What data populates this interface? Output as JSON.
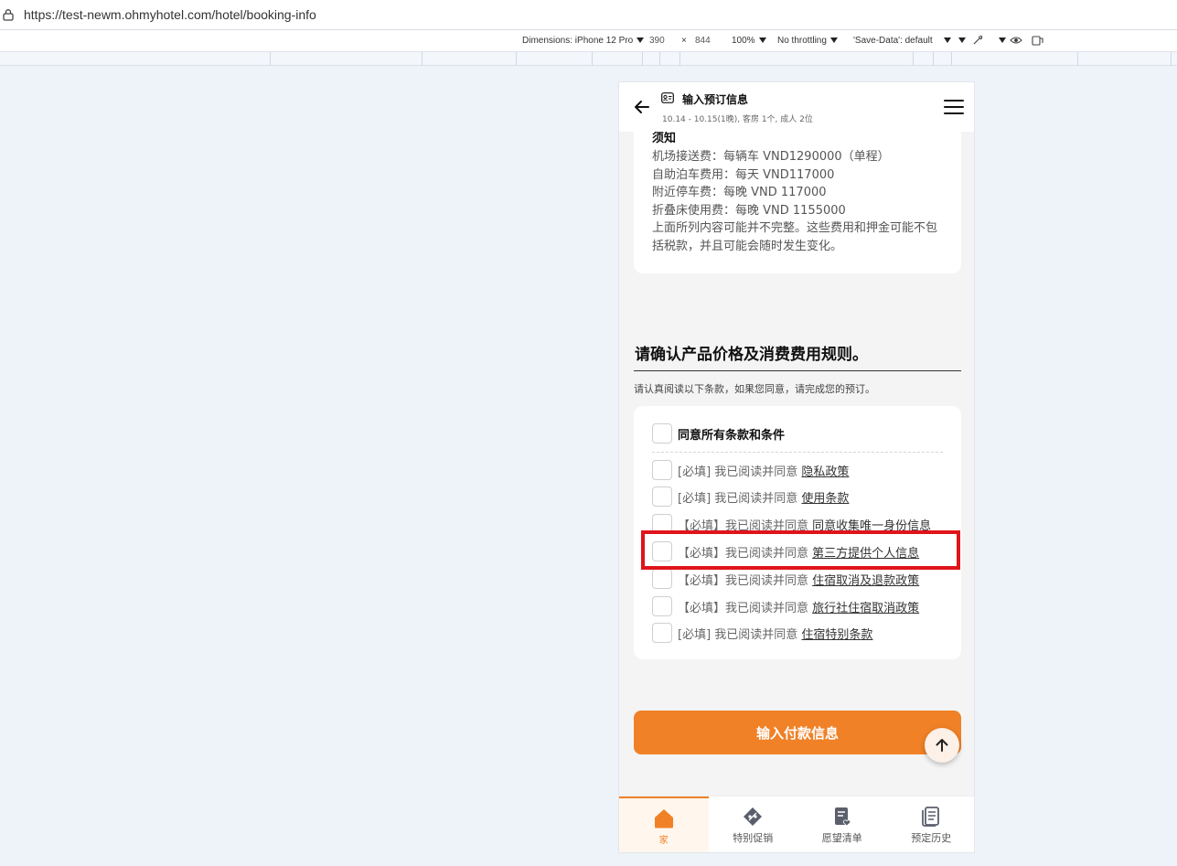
{
  "browser": {
    "url": "https://test-newm.ohmyhotel.com/hotel/booking-info"
  },
  "devtools": {
    "dimensions": "Dimensions: iPhone 12 Pro",
    "width": "390",
    "times": "×",
    "height": "844",
    "zoom": "100%",
    "throttling": "No throttling",
    "save_data": "'Save-Data': default"
  },
  "header": {
    "title": "输入预订信息",
    "subtitle": "10.14 - 10.15(1晚), 客房 1个, 成人 2位"
  },
  "notice": {
    "heading": "须知",
    "lines": [
      "机场接送费：每辆车 VND1290000（单程）",
      "自助泊车费用：每天 VND117000",
      "附近停车费：每晚 VND 117000",
      "折叠床使用费：每晚 VND 1155000",
      "上面所列内容可能并不完整。这些费用和押金可能不包括税款，并且可能会随时发生变化。"
    ]
  },
  "rules": {
    "title": "请确认产品价格及消费费用规则。",
    "description": "请认真阅读以下条款，如果您同意，请完成您的预订。",
    "agree_all": "同意所有条款和条件",
    "terms": [
      {
        "prefix": "[必填] 我已阅读并同意 ",
        "link": "隐私政策"
      },
      {
        "prefix": "[必填] 我已阅读并同意 ",
        "link": "使用条款"
      },
      {
        "prefix": "【必填】我已阅读并同意 ",
        "link": "同意收集唯一身份信息"
      },
      {
        "prefix": "【必填】我已阅读并同意 ",
        "link": "第三方提供个人信息"
      },
      {
        "prefix": "【必填】我已阅读并同意 ",
        "link": "住宿取消及退款政策"
      },
      {
        "prefix": "【必填】我已阅读并同意 ",
        "link": "旅行社住宿取消政策"
      },
      {
        "prefix": "[必填] 我已阅读并同意 ",
        "link": "住宿特别条款"
      }
    ]
  },
  "cta": {
    "label": "输入付款信息"
  },
  "bottom_nav": [
    {
      "label": "家",
      "icon": "home-icon",
      "active": true
    },
    {
      "label": "特别促销",
      "icon": "promotion-tag-icon",
      "active": false
    },
    {
      "label": "愿望清单",
      "icon": "wishlist-icon",
      "active": false
    },
    {
      "label": "预定历史",
      "icon": "booking-history-icon",
      "active": false
    }
  ],
  "colors": {
    "accent": "#f08127",
    "highlight": "#e0141b",
    "page_bg": "#eef2f9"
  }
}
